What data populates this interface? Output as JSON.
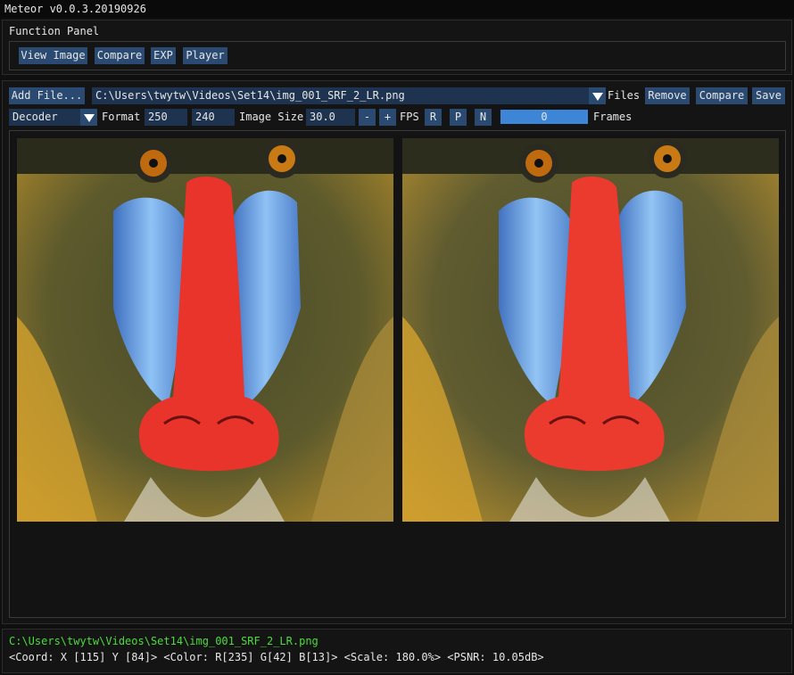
{
  "app": {
    "title": "Meteor v0.0.3.20190926"
  },
  "function_panel": {
    "title": "Function Panel",
    "buttons": [
      "View Image",
      "Compare",
      "EXP",
      "Player"
    ]
  },
  "toolbar": {
    "add_file": "Add File...",
    "file_path": "C:\\Users\\twytw\\Videos\\Set14\\img_001_SRF_2_LR.png",
    "files_label": "Files",
    "remove": "Remove",
    "compare": "Compare",
    "save": "Save"
  },
  "controls": {
    "decoder": "Decoder",
    "format_label": "Format",
    "width": "250",
    "height": "240",
    "image_size_label": "Image Size",
    "fps_value": "30.0",
    "minus": "-",
    "plus": "+",
    "fps_label": "FPS",
    "r": "R",
    "p": "P",
    "n": "N",
    "frame_value": "0",
    "frames_label": "Frames"
  },
  "status": {
    "path": "C:\\Users\\twytw\\Videos\\Set14\\img_001_SRF_2_LR.png",
    "info": "<Coord: X [115]  Y [84]> <Color: R[235] G[42] B[13]> <Scale: 180.0%> <PSNR: 10.05dB>"
  },
  "colors": {
    "accent": "#2a4a72",
    "field": "#1d3350",
    "progress": "#3d85d6",
    "status_path": "#4cdc3c"
  },
  "icons": {
    "dropdown": "triangle-down-icon"
  }
}
